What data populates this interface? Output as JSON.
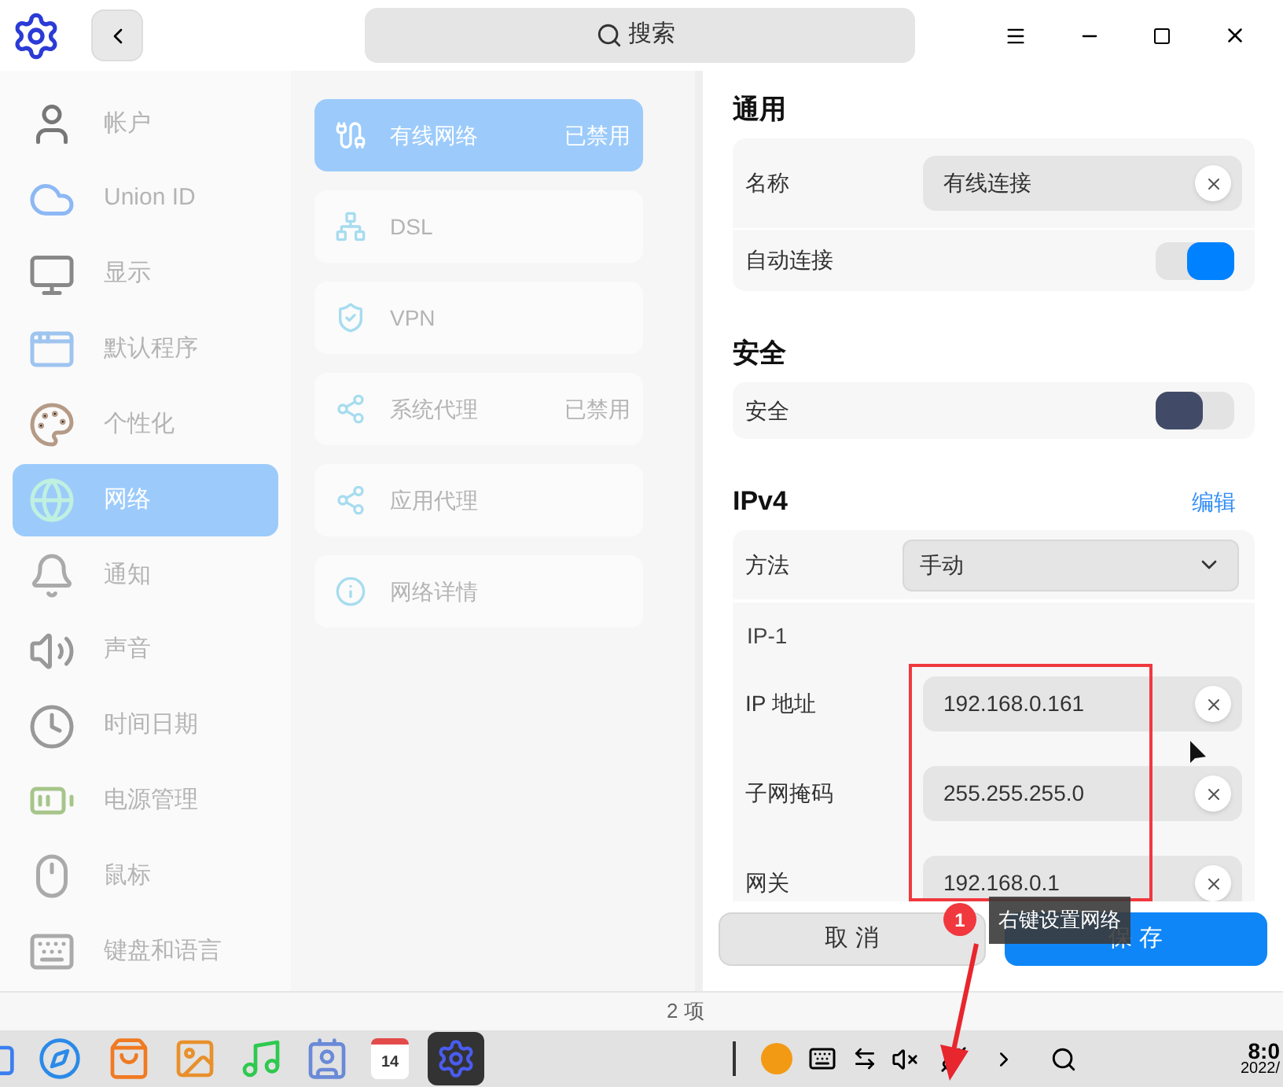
{
  "header": {
    "search_placeholder": "搜索"
  },
  "sidebar": {
    "items": [
      {
        "label": "帐户",
        "selected": false
      },
      {
        "label": "Union ID",
        "selected": false
      },
      {
        "label": "显示",
        "selected": false
      },
      {
        "label": "默认程序",
        "selected": false
      },
      {
        "label": "个性化",
        "selected": false
      },
      {
        "label": "网络",
        "selected": true
      },
      {
        "label": "通知",
        "selected": false
      },
      {
        "label": "声音",
        "selected": false
      },
      {
        "label": "时间日期",
        "selected": false
      },
      {
        "label": "电源管理",
        "selected": false
      },
      {
        "label": "鼠标",
        "selected": false
      },
      {
        "label": "键盘和语言",
        "selected": false
      }
    ]
  },
  "network_menu": {
    "items": [
      {
        "label": "有线网络",
        "status": "已禁用",
        "selected": true
      },
      {
        "label": "DSL",
        "selected": false
      },
      {
        "label": "VPN",
        "selected": false
      },
      {
        "label": "系统代理",
        "status": "已禁用",
        "selected": false
      },
      {
        "label": "应用代理",
        "selected": false
      },
      {
        "label": "网络详情",
        "selected": false
      }
    ]
  },
  "settings": {
    "sections": [
      {
        "title": "通用",
        "rows": [
          {
            "kind": "text",
            "label": "名称",
            "value": "有线连接"
          },
          {
            "kind": "switch",
            "label": "自动连接",
            "on": true
          }
        ]
      },
      {
        "title": "安全",
        "rows": [
          {
            "kind": "switch",
            "label": "安全",
            "on": false
          }
        ]
      },
      {
        "title": "IPv4",
        "action": "编辑",
        "rows": [
          {
            "kind": "select",
            "label": "方法",
            "value": "手动"
          },
          {
            "kind": "group",
            "label": "IP-1"
          },
          {
            "kind": "text",
            "label": "IP 地址",
            "value": "192.168.0.161"
          },
          {
            "kind": "text",
            "label": "子网掩码",
            "value": "255.255.255.0"
          },
          {
            "kind": "text",
            "label": "网关",
            "value": "192.168.0.1"
          }
        ]
      }
    ],
    "buttons": [
      {
        "label": "取 消",
        "primary": false
      },
      {
        "label": "保 存",
        "primary": true
      }
    ]
  },
  "status_bar": "2 项",
  "taskbar": {
    "calendar_day": "14",
    "clock_time": "8:0",
    "clock_date": "2022/"
  },
  "annotation": {
    "badge": "1",
    "tooltip": "右键设置网络"
  }
}
